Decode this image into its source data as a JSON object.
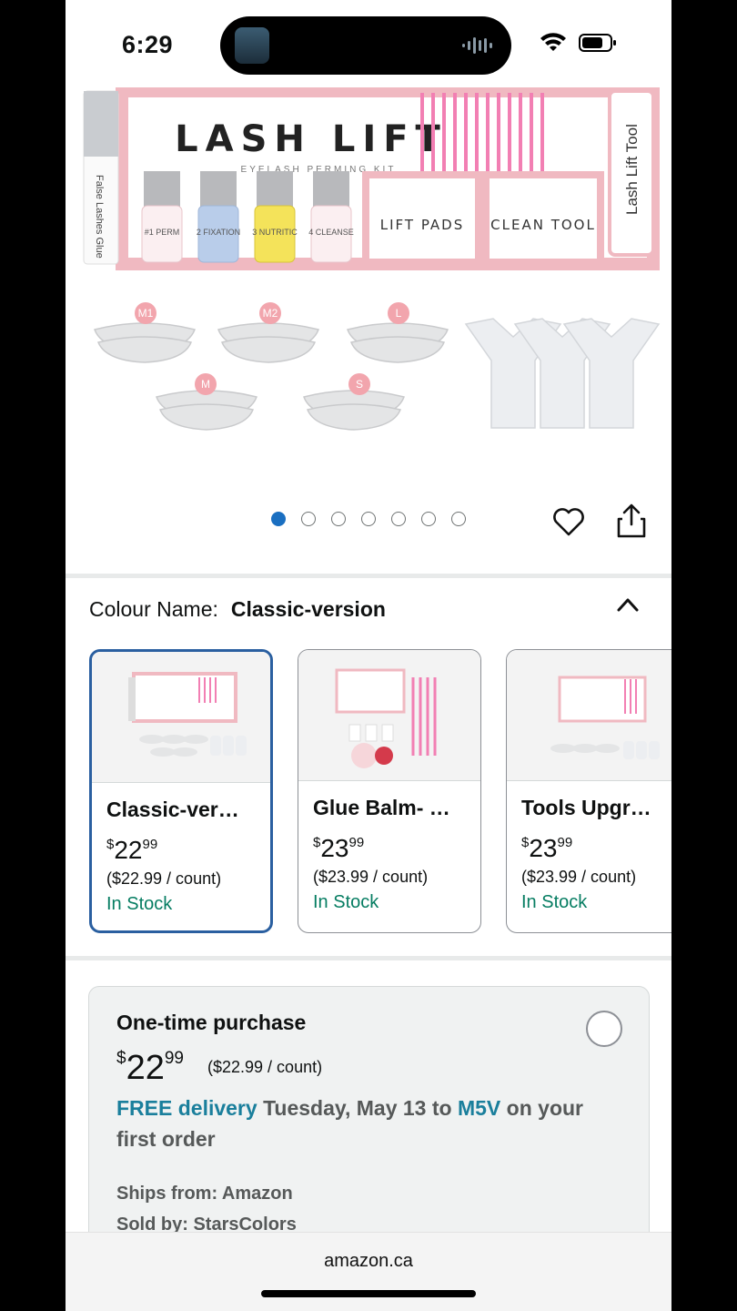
{
  "status_bar": {
    "time": "6:29"
  },
  "hero": {
    "image_title": "LASH LIFT",
    "image_subtitle": "EYELASH PERMING KIT",
    "bottles": [
      "#1 PERM",
      "2 FIXATION",
      "3 NUTRITIC",
      "4 CLEANSE"
    ],
    "glue_label": "False Lashes Glue",
    "pads_label": "LIFT PADS",
    "tool_label": "CLEAN TOOL",
    "side_label": "Lash Lift Tool",
    "rod_labels": [
      "M1",
      "M2",
      "L",
      "M",
      "S"
    ],
    "dots_count": 7,
    "active_dot": 0
  },
  "colour": {
    "label": "Colour Name:",
    "value": "Classic-version"
  },
  "variants": [
    {
      "name": "Classic-ver…",
      "price_whole": "22",
      "price_cents": "99",
      "unit": "($22.99 / count)",
      "stock": "In Stock",
      "selected": true
    },
    {
      "name": "Glue Balm- …",
      "price_whole": "23",
      "price_cents": "99",
      "unit": "($23.99 / count)",
      "stock": "In Stock",
      "selected": false
    },
    {
      "name": "Tools Upgr…",
      "price_whole": "23",
      "price_cents": "99",
      "unit": "($23.99 / count)",
      "stock": "In Stock",
      "selected": false
    }
  ],
  "buybox": {
    "title": "One-time purchase",
    "price_whole": "22",
    "price_cents": "99",
    "per_count": "($22.99 / count)",
    "free_delivery": "FREE delivery",
    "delivery_date": "Tuesday, May 13",
    "to_text": "to",
    "postal": "M5V",
    "on_first": "on your first order",
    "ships_from": "Ships from: Amazon",
    "sold_by": "Sold by: StarsColors"
  },
  "browser": {
    "url": "amazon.ca"
  },
  "colors": {
    "accent_blue": "#1a6fc1",
    "selected_border": "#2a5fa0",
    "link_teal": "#1a7f9c",
    "stock_green": "#067d62",
    "product_pink": "#f2b8c0"
  }
}
